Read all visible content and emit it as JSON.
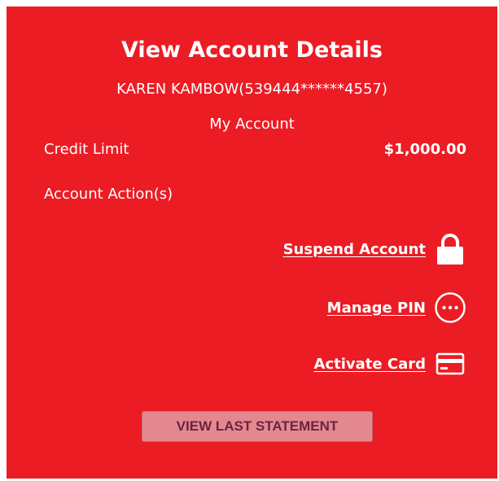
{
  "page": {
    "title": "View Account Details",
    "account_holder": "KAREN KAMBOW(539444******4557)",
    "section_label": "My Account"
  },
  "credit": {
    "label": "Credit Limit",
    "value": "$1,000.00"
  },
  "actions": {
    "label": "Account Action(s)",
    "items": [
      {
        "label": "Suspend Account",
        "icon": "lock-icon"
      },
      {
        "label": "Manage PIN",
        "icon": "pin-dots-icon"
      },
      {
        "label": "Activate Card",
        "icon": "credit-card-icon"
      }
    ]
  },
  "statement_button": {
    "label": "VIEW LAST STATEMENT"
  },
  "colors": {
    "panel_background": "#ec1c24",
    "text": "#ffffff",
    "button_background": "#e48890",
    "button_text": "#6b2340"
  }
}
